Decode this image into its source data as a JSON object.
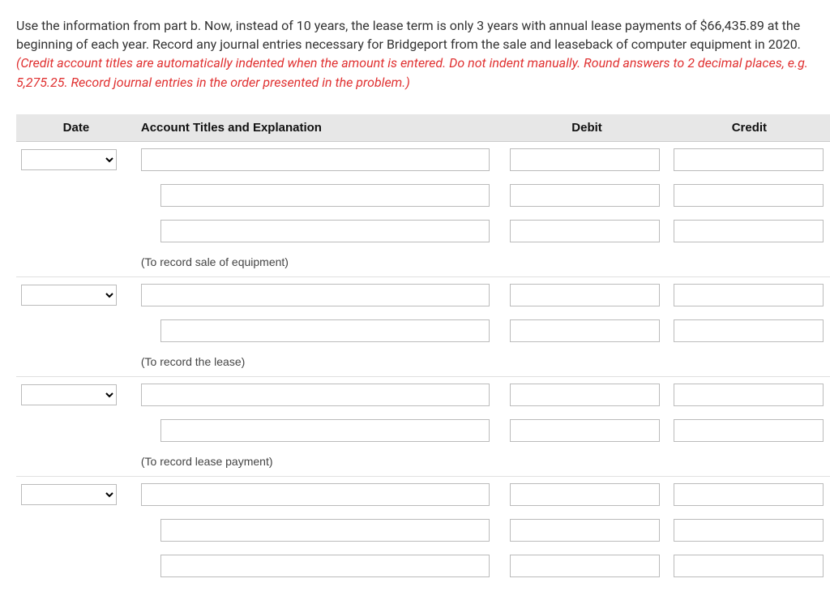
{
  "instructions": {
    "part1": "Use the information from part b. Now, instead of 10 years, the lease term is only 3 years with annual lease payments of $66,435.89 at the beginning of each year. Record any journal entries necessary for Bridgeport from the sale and leaseback of computer equipment in 2020. ",
    "part2_red": "(Credit account titles are automatically indented when the amount is entered. Do not indent manually. Round answers to 2 decimal places, e.g. 5,275.25. Record journal entries in the order presented in the problem.)"
  },
  "headers": {
    "date": "Date",
    "account": "Account Titles and Explanation",
    "debit": "Debit",
    "credit": "Credit"
  },
  "explanations": {
    "e1": "(To record sale of equipment)",
    "e2": "(To record the lease)",
    "e3": "(To record lease payment)"
  }
}
